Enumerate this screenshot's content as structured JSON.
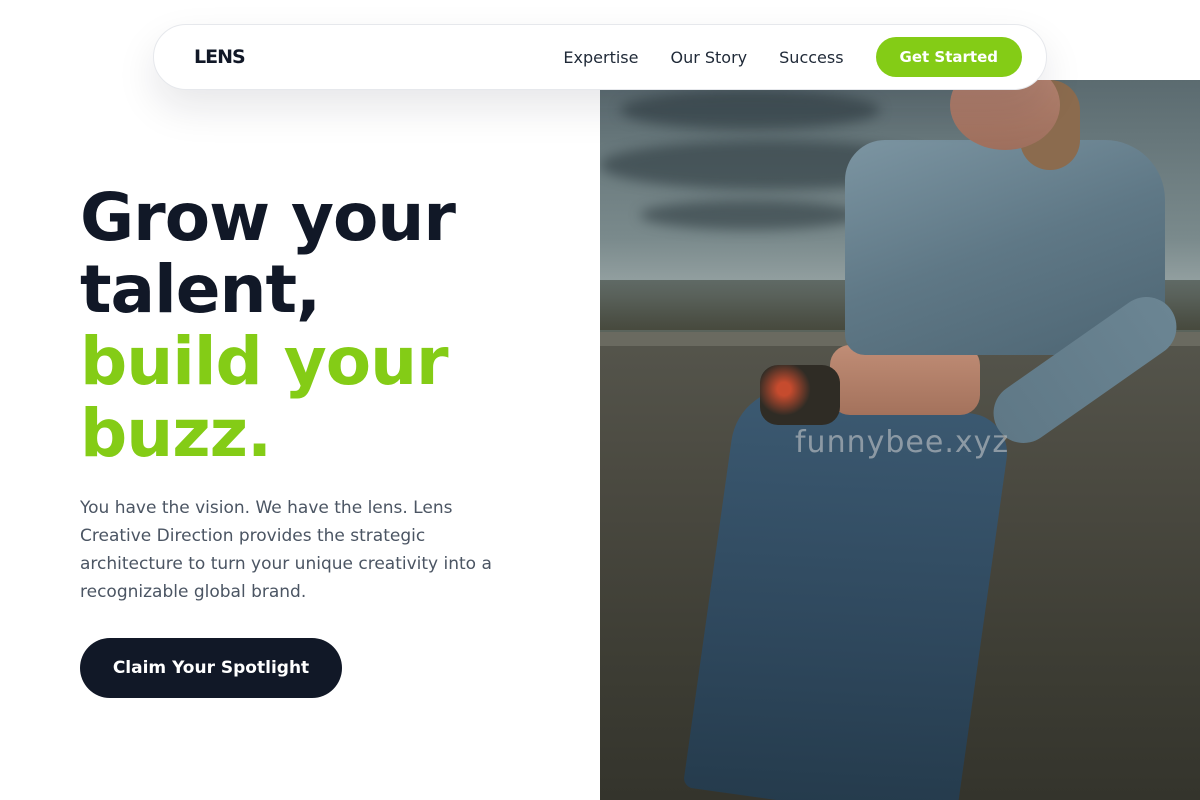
{
  "brand": {
    "logo_text": "LENS"
  },
  "nav": {
    "links": [
      "Expertise",
      "Our Story",
      "Success"
    ],
    "cta_label": "Get Started"
  },
  "hero": {
    "headline_line1": "Grow your",
    "headline_line2": "talent,",
    "headline_line3": "build your",
    "headline_line4": "buzz.",
    "lead": "You have the vision. We have the lens. Lens Creative Direction provides the strategic architecture to turn your unique creativity into a recognizable global brand.",
    "cta_label": "Claim Your Spotlight",
    "image_watermark": "funnybee.xyz"
  },
  "colors": {
    "accent": "#84cc16",
    "dark": "#111827",
    "body_text": "#4b5563"
  }
}
